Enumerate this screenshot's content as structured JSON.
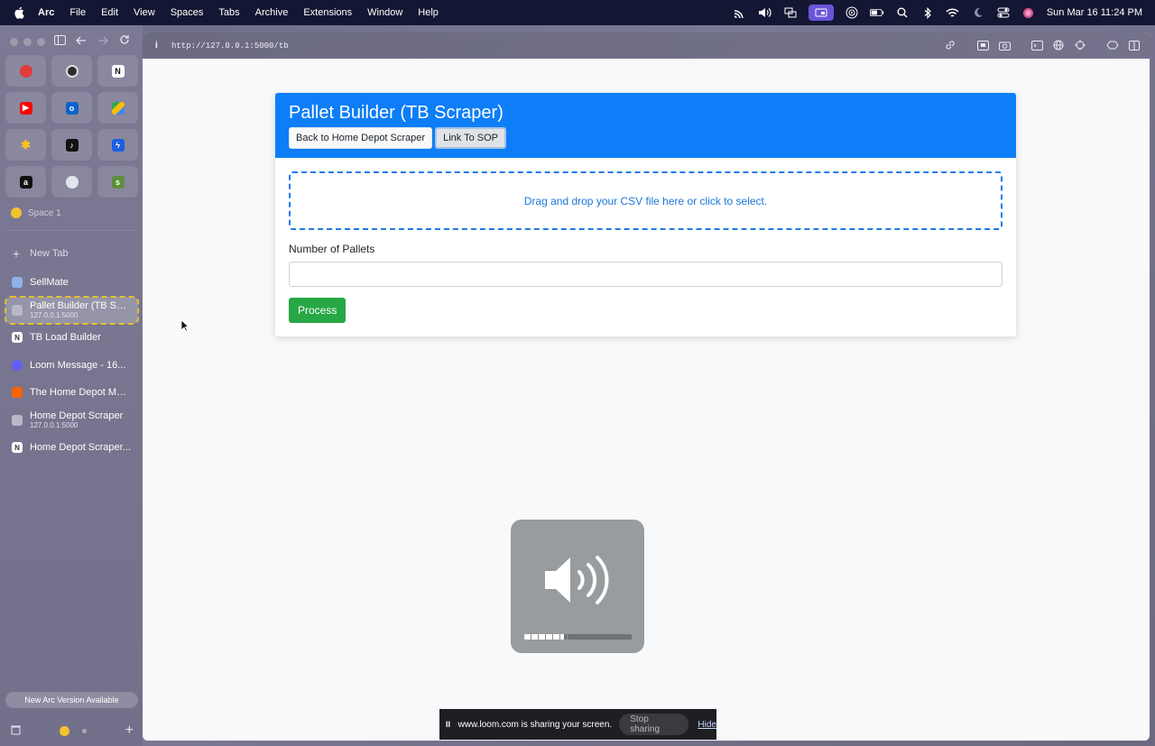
{
  "menubar": {
    "app_name": "Arc",
    "items": [
      "File",
      "Edit",
      "View",
      "Spaces",
      "Tabs",
      "Archive",
      "Extensions",
      "Window",
      "Help"
    ],
    "clock": "Sun Mar 16  11:24 PM"
  },
  "sidebar": {
    "space_name": "Space 1",
    "new_tab_label": "New Tab",
    "tabs": [
      {
        "title": "SellMate",
        "subtitle": ""
      },
      {
        "title": "Pallet Builder (TB Scraper)",
        "subtitle": "127.0.0.1:5000"
      },
      {
        "title": "TB Load Builder",
        "subtitle": ""
      },
      {
        "title": "Loom Message - 16...",
        "subtitle": ""
      },
      {
        "title": "The Home Depot Mar...",
        "subtitle": ""
      },
      {
        "title": "Home Depot Scraper",
        "subtitle": "127.0.0.1:5000"
      },
      {
        "title": "Home Depot Scraper...",
        "subtitle": ""
      }
    ],
    "update_label": "New Arc Version Available"
  },
  "browser": {
    "url": "http://127.0.0.1:5000/tb"
  },
  "page": {
    "title": "Pallet Builder (TB Scraper)",
    "back_button": "Back to Home Depot Scraper",
    "sop_button": "Link To SOP",
    "dropzone_text": "Drag and drop your CSV file here or click to select.",
    "pallets_label": "Number of Pallets",
    "pallets_value": "",
    "process_button": "Process"
  },
  "volume_hud": {
    "level": 0.37
  },
  "loom": {
    "pause_glyph": "II",
    "message": "www.loom.com is sharing your screen.",
    "stop_label": "Stop sharing",
    "hide_label": "Hide"
  },
  "colors": {
    "header_blue": "#0d7ef8",
    "success_green": "#28a745",
    "active_tab_outline": "#e6c02b"
  }
}
